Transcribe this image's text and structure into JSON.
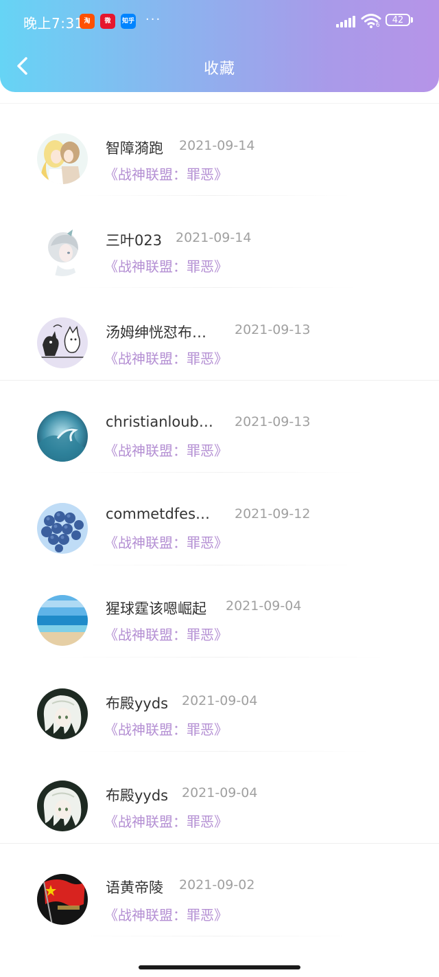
{
  "status_bar": {
    "time": "晚上7:31",
    "apps": [
      {
        "name": "taobao-app-icon",
        "label": "淘",
        "bg": "#ff5000"
      },
      {
        "name": "weibo-app-icon",
        "label": "微",
        "bg": "#e6162d"
      },
      {
        "name": "zhihu-app-icon",
        "label": "知乎",
        "bg": "#0084ff"
      }
    ],
    "more": "···",
    "wifi_badge": "6",
    "battery": "42"
  },
  "header": {
    "title": "收藏"
  },
  "favorites": [
    {
      "username": "智障漪跑",
      "date": "2021-09-14",
      "work": "《战神联盟：罪恶》",
      "avatar": "anime-couple"
    },
    {
      "username": "三叶023",
      "date": "2021-09-14",
      "work": "《战神联盟：罪恶》",
      "avatar": "anime-girl-pale"
    },
    {
      "username": "汤姆绅恍怼布…",
      "date": "2021-09-13",
      "work": "《战神联盟：罪恶》",
      "avatar": "cartoon-cats"
    },
    {
      "username": "christianloub…",
      "date": "2021-09-13",
      "work": "《战神联盟：罪恶》",
      "avatar": "ocean-wave"
    },
    {
      "username": "commetdfes…",
      "date": "2021-09-12",
      "work": "《战神联盟：罪恶》",
      "avatar": "blue-balloons"
    },
    {
      "username": "猩球霆该嗯崛起",
      "date": "2021-09-04",
      "work": "《战神联盟：罪恶》",
      "avatar": "beach-sea"
    },
    {
      "username": "布殿yyds",
      "date": "2021-09-04",
      "work": "《战神联盟：罪恶》",
      "avatar": "white-hair-boy"
    },
    {
      "username": "布殿yyds",
      "date": "2021-09-04",
      "work": "《战神联盟：罪恶》",
      "avatar": "white-hair-boy"
    },
    {
      "username": "语黄帝陵",
      "date": "2021-09-02",
      "work": "《战神联盟：罪恶》",
      "avatar": "red-flag"
    }
  ],
  "colors": {
    "accent_purple": "#b48fd3",
    "header_gradient_start": "#66d4f5",
    "header_gradient_end": "#b694e8"
  }
}
